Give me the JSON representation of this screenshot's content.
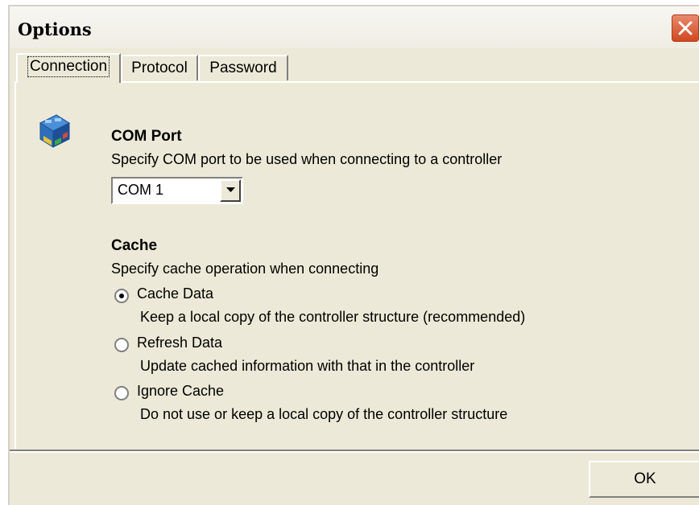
{
  "window": {
    "title": "Options"
  },
  "tabs": [
    {
      "label": "Connection",
      "active": true
    },
    {
      "label": "Protocol",
      "active": false
    },
    {
      "label": "Password",
      "active": false
    }
  ],
  "com_port": {
    "heading": "COM Port",
    "description": "Specify COM port to be used when connecting to a controller",
    "selected": "COM 1"
  },
  "cache": {
    "heading": "Cache",
    "description": "Specify cache operation when connecting",
    "options": [
      {
        "label": "Cache Data",
        "description": "Keep a local copy of the controller structure (recommended)",
        "selected": true
      },
      {
        "label": "Refresh Data",
        "description": "Update cached information with that in the controller",
        "selected": false
      },
      {
        "label": "Ignore Cache",
        "description": "Do not use or keep a local copy of the controller structure",
        "selected": false
      }
    ]
  },
  "buttons": {
    "ok": "OK"
  },
  "icons": {
    "close": "close-icon",
    "app": "controller-icon",
    "dropdown": "chevron-down-icon"
  },
  "colors": {
    "dialog_bg": "#ece9d8",
    "close_button": "#d0481f"
  }
}
